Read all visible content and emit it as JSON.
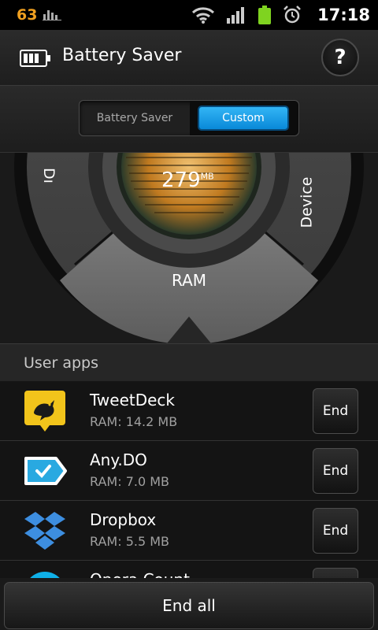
{
  "status_bar": {
    "notification_count": "63",
    "time": "17:18",
    "icons": [
      "stats-icon",
      "wifi-icon",
      "signal-icon",
      "battery-icon",
      "alarm-icon"
    ]
  },
  "header": {
    "title": "Battery Saver",
    "help_label": "?"
  },
  "mode_toggle": {
    "options": [
      "Battery Saver",
      "Custom"
    ],
    "selected": "Custom",
    "accent": "#1aa0ec"
  },
  "dial": {
    "ram_value": "279",
    "ram_unit": "MB",
    "center_label": "RAM",
    "right_label": "Device",
    "left_label_fragment": "Dı"
  },
  "user_apps": {
    "title": "User apps",
    "end_label": "End",
    "apps": [
      {
        "name": "TweetDeck",
        "ram": "RAM: 14.2 MB",
        "icon": "tweetdeck-icon"
      },
      {
        "name": "Any.DO",
        "ram": "RAM: 7.0 MB",
        "icon": "anydo-icon"
      },
      {
        "name": "Dropbox",
        "ram": "RAM: 5.5 MB",
        "icon": "dropbox-icon"
      },
      {
        "name": "Opera Count",
        "ram": "",
        "icon": "app-icon-partial"
      }
    ]
  },
  "footer": {
    "end_all_label": "End all"
  }
}
